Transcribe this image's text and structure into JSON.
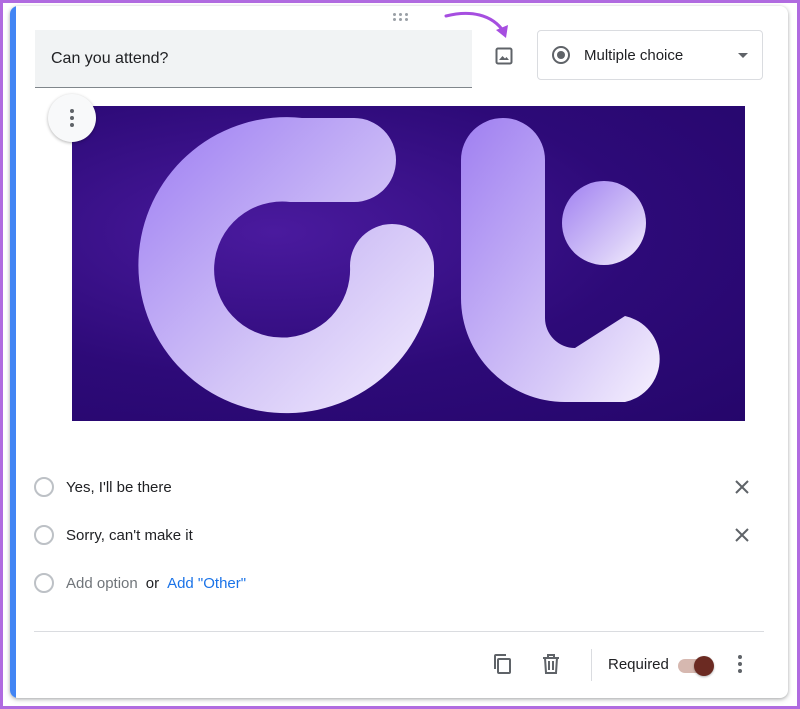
{
  "question": {
    "title": "Can you attend?",
    "type_label": "Multiple choice"
  },
  "icons": {
    "drag": "drag-handle-icon",
    "add_image": "image-icon",
    "dropdown": "chevron-down-icon",
    "image_menu": "more-vert-icon",
    "remove": "close-icon",
    "duplicate": "copy-icon",
    "delete": "trash-icon",
    "more": "more-vert-icon"
  },
  "options": [
    {
      "label": "Yes,  I'll be there"
    },
    {
      "label": "Sorry, can't make it"
    }
  ],
  "add_option": {
    "label": "Add option",
    "or_label": "or",
    "other_label": "Add \"Other\""
  },
  "footer": {
    "required_label": "Required",
    "required_on": true
  },
  "colors": {
    "accent": "#4285f4",
    "link": "#1a73e8",
    "frame": "#b06be0",
    "toggle_thumb": "#6b2a22",
    "image_bg": "#2d0a78"
  }
}
